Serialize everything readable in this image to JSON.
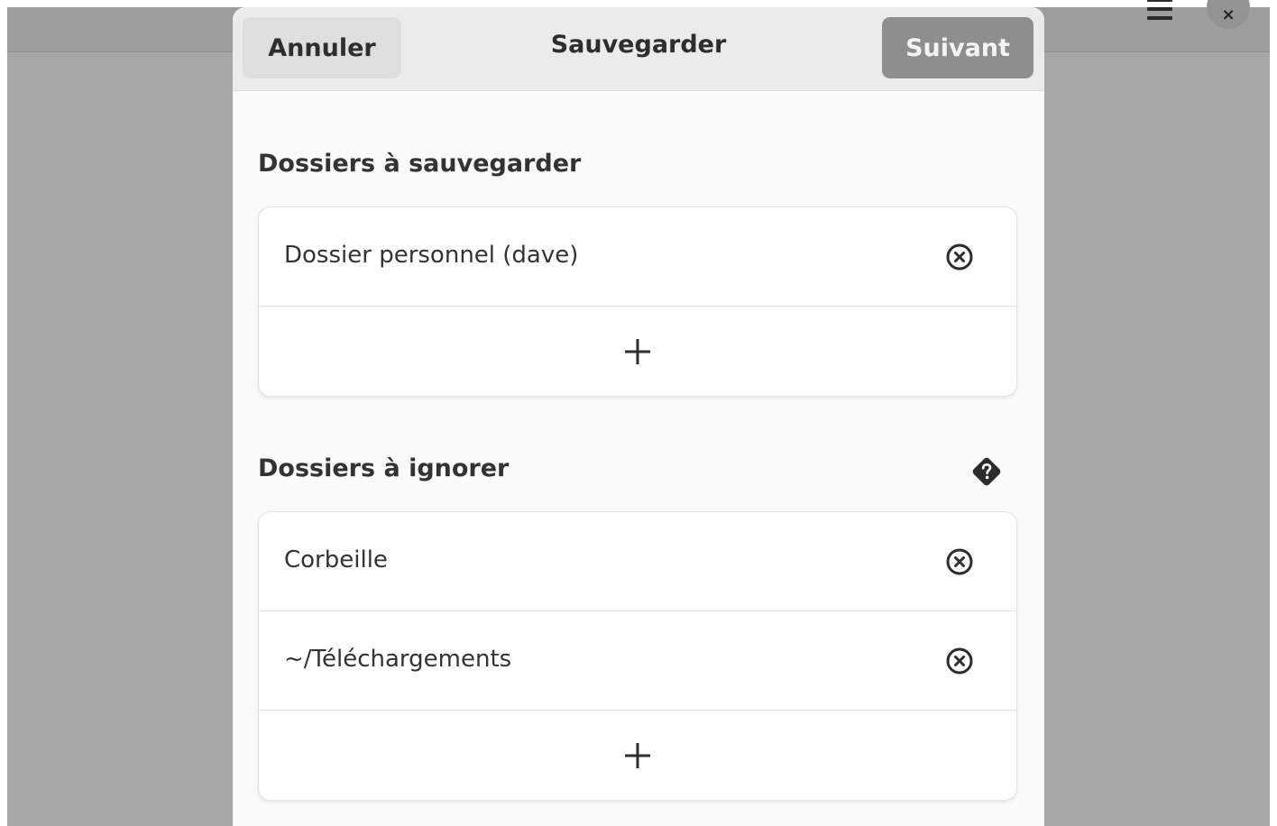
{
  "dialog": {
    "title": "Sauvegarder",
    "cancel_label": "Annuler",
    "next_label": "Suivant"
  },
  "include_section": {
    "title": "Dossiers à sauvegarder",
    "items": [
      {
        "label": "Dossier personnel (dave)",
        "action_icon": "remove-circle-icon"
      }
    ],
    "add_icon": "plus-icon"
  },
  "exclude_section": {
    "title": "Dossiers à ignorer",
    "help_icon": "help-icon",
    "items": [
      {
        "label": "Corbeille",
        "action_icon": "remove-circle-icon"
      },
      {
        "label": "~/Téléchargements",
        "action_icon": "remove-circle-icon"
      }
    ],
    "add_icon": "plus-icon"
  },
  "background_window": {
    "menu_icon": "hamburger-menu-icon",
    "close_icon": "close-icon",
    "close_glyph": "×"
  },
  "colors": {
    "backdrop": "#a7a7a7",
    "header_bg": "#ebebeb",
    "next_button_bg": "#8e8e8e",
    "cancel_button_bg": "#dedede"
  }
}
